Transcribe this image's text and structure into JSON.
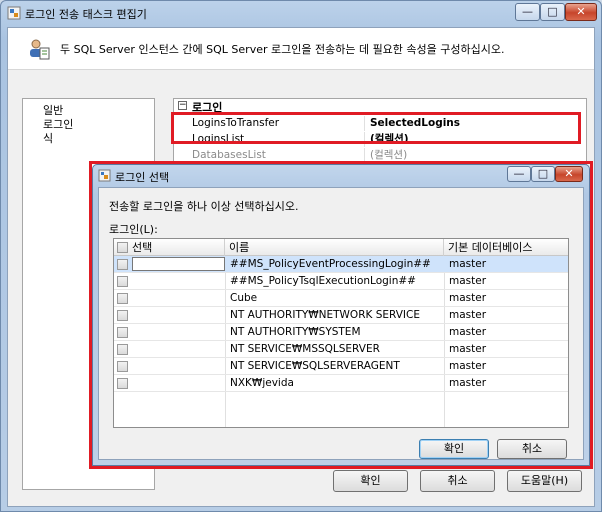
{
  "outer": {
    "title": "로그인 전송 태스크 편집기",
    "description": "두 SQL Server 인스턴스 간에 SQL Server 로그인을 전송하는 데 필요한 속성을 구성하십시오.",
    "nav_items": [
      "일반",
      "로그인",
      "식"
    ],
    "section_title": "로그인",
    "properties": [
      {
        "name": "LoginsToTransfer",
        "value": "SelectedLogins"
      },
      {
        "name": "LoginsList",
        "value": "(컬렉션)"
      },
      {
        "name": "DatabasesList",
        "value": "(컬렉션)"
      }
    ],
    "buttons": {
      "ok": "확인",
      "cancel": "취소",
      "help": "도움말(H)"
    },
    "controls": {
      "minimize": "—",
      "maximize": "□",
      "close": "✕"
    }
  },
  "dialog": {
    "title": "로그인 선택",
    "description": "전송할 로그인을 하나 이상 선택하십시오.",
    "list_label": "로그인(L):",
    "columns": {
      "select": "선택",
      "name": "이름",
      "db": "기본 데이터베이스"
    },
    "rows": [
      {
        "name": "##MS_PolicyEventProcessingLogin##",
        "db": "master"
      },
      {
        "name": "##MS_PolicyTsqlExecutionLogin##",
        "db": "master"
      },
      {
        "name": "Cube",
        "db": "master"
      },
      {
        "name": "NT AUTHORITY₩NETWORK SERVICE",
        "db": "master"
      },
      {
        "name": "NT AUTHORITY₩SYSTEM",
        "db": "master"
      },
      {
        "name": "NT SERVICE₩MSSQLSERVER",
        "db": "master"
      },
      {
        "name": "NT SERVICE₩SQLSERVERAGENT",
        "db": "master"
      },
      {
        "name": "NXK₩jevida",
        "db": "master"
      }
    ],
    "buttons": {
      "ok": "확인",
      "cancel": "취소"
    },
    "controls": {
      "minimize": "—",
      "maximize": "□",
      "close": "✕"
    }
  },
  "colors": {
    "highlight": "#e01b24",
    "selected_row": "#cfe3fb"
  }
}
